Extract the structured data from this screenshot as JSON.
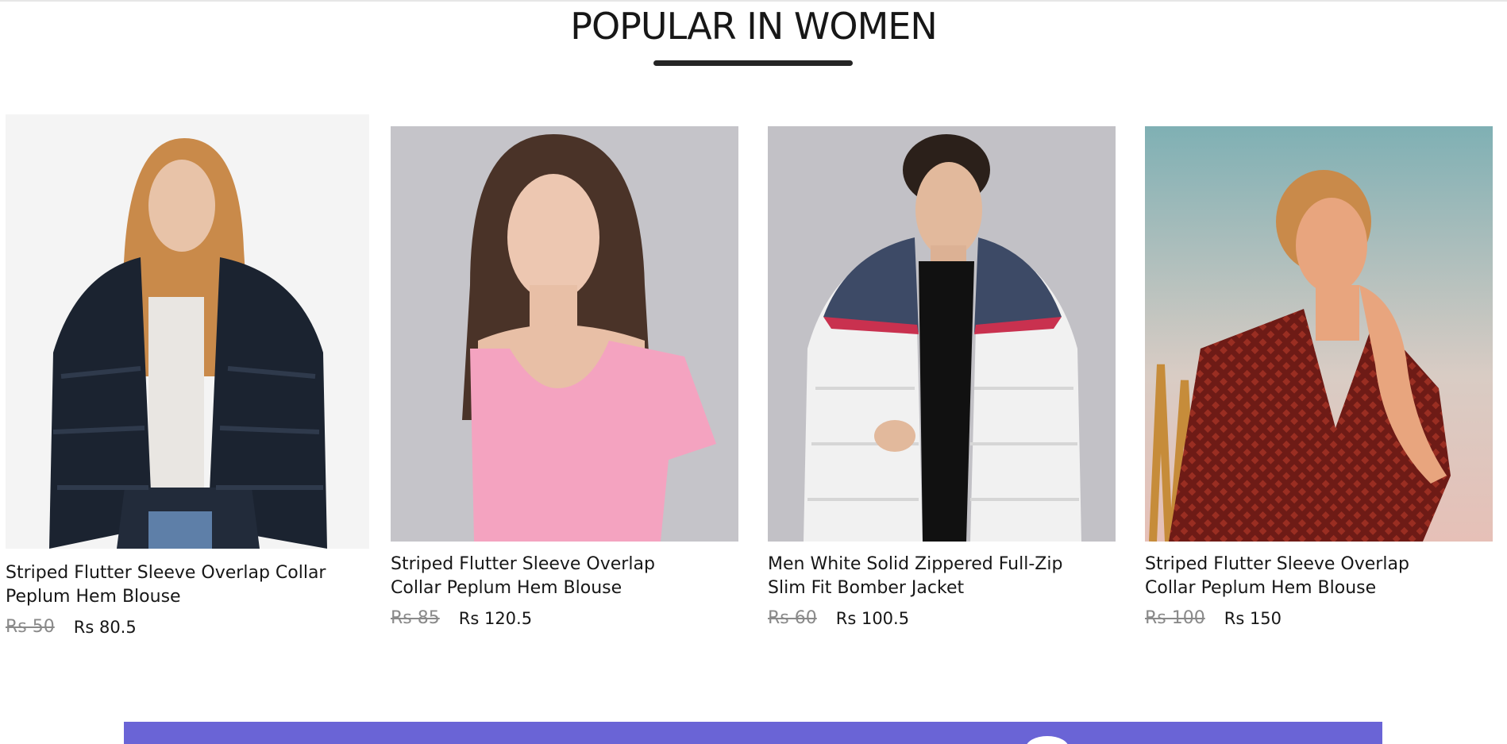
{
  "section": {
    "title": "POPULAR IN WOMEN"
  },
  "products": [
    {
      "name": "Striped Flutter Sleeve Overlap Collar Peplum Hem Blouse",
      "old_price": "Rs 50",
      "new_price": "Rs 80.5"
    },
    {
      "name": "Striped Flutter Sleeve Overlap Collar Peplum Hem Blouse",
      "old_price": "Rs 85",
      "new_price": "Rs 120.5"
    },
    {
      "name": "Men White Solid Zippered Full-Zip Slim Fit Bomber Jacket",
      "old_price": "Rs 60",
      "new_price": "Rs 100.5"
    },
    {
      "name": "Striped Flutter Sleeve Overlap Collar Peplum Hem Blouse",
      "old_price": "Rs 100",
      "new_price": "Rs 150"
    }
  ],
  "colors": {
    "banner": "#6a64d6",
    "underline": "#252525",
    "old_price": "#8a8a8a"
  }
}
